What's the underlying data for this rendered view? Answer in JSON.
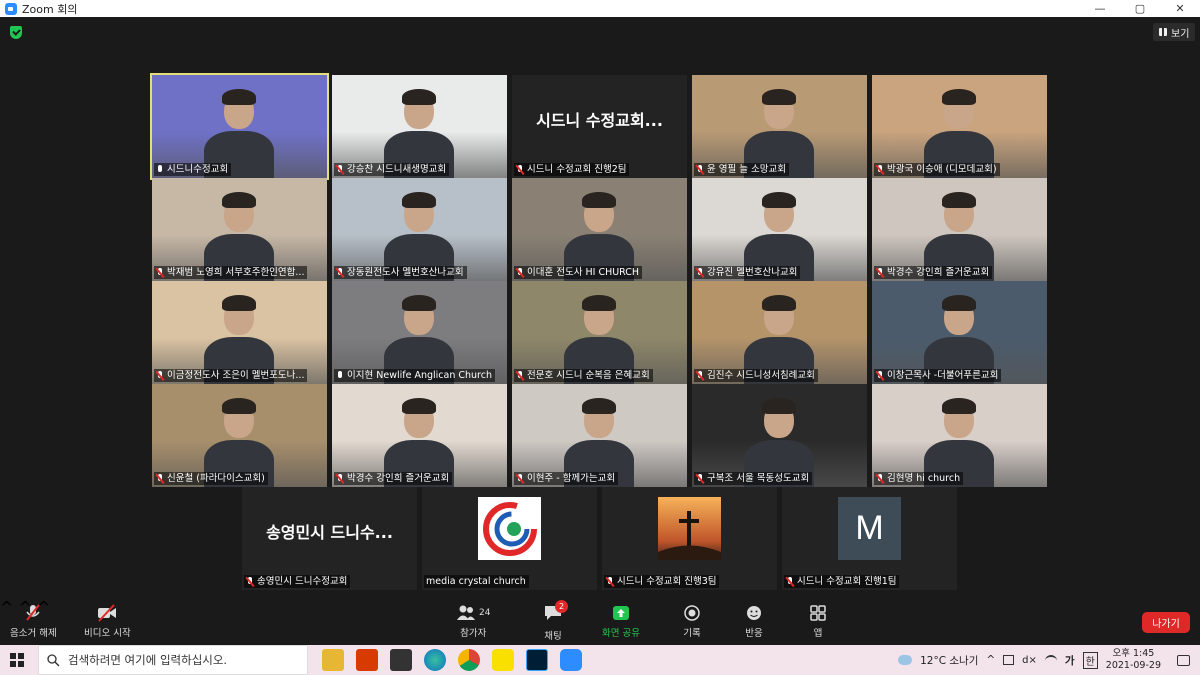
{
  "window": {
    "title": "Zoom 회의",
    "controls": [
      "—",
      "▢",
      "✕"
    ]
  },
  "view_button": "보기",
  "tiles": [
    {
      "name": "시드니수정교회",
      "muted": false,
      "active": true,
      "kind": "video",
      "bg": "#6f71c7"
    },
    {
      "name": "강승찬 시드니새생명교회",
      "muted": true,
      "kind": "video",
      "bg": "#e9eaea"
    },
    {
      "name": "시드니 수정교회 진행2팀",
      "muted": true,
      "kind": "text",
      "display": "시드니 수정교회..."
    },
    {
      "name": "윤 영필 늘 소망교회",
      "muted": true,
      "kind": "video",
      "bg": "#b89a74"
    },
    {
      "name": "박광국 이승애 (디모데교회)",
      "muted": true,
      "kind": "video",
      "bg": "#c9a47e"
    },
    {
      "name": "박재범 노영희 서부호주한인연합...",
      "muted": true,
      "kind": "video",
      "bg": "#c7b8a6"
    },
    {
      "name": "장동원전도사 멜번호산나교회",
      "muted": true,
      "kind": "video",
      "bg": "#b7c0c8"
    },
    {
      "name": "이대훈 전도사 HI CHURCH",
      "muted": true,
      "kind": "video",
      "bg": "#8a8174"
    },
    {
      "name": "강유진 멜번호산나교회",
      "muted": true,
      "kind": "video",
      "bg": "#dcd8d3"
    },
    {
      "name": "박경수 강인희 즐거운교회",
      "muted": true,
      "kind": "video",
      "bg": "#cfc7bf"
    },
    {
      "name": "이금정전도사 조은이 멜번포도나...",
      "muted": true,
      "kind": "video",
      "bg": "#d9c3a2"
    },
    {
      "name": "이지현 Newlife Anglican Church",
      "muted": false,
      "kind": "video",
      "bg": "#7d7d80"
    },
    {
      "name": "전문호 시드니 순복음 은혜교회",
      "muted": true,
      "kind": "video",
      "bg": "#8f876a"
    },
    {
      "name": "김진수 시드니성서침례교회",
      "muted": true,
      "kind": "video",
      "bg": "#b5946a"
    },
    {
      "name": "이창근목사 -더불어푸른교회",
      "muted": true,
      "kind": "video",
      "bg": "#4b5b6c"
    },
    {
      "name": "신윤철 (파라다이스교회)",
      "muted": true,
      "kind": "video",
      "bg": "#a88f6c"
    },
    {
      "name": "박경수 강인희 즐거운교회",
      "muted": true,
      "kind": "video",
      "bg": "#e2dad0"
    },
    {
      "name": "이현주 - 함께가는교회",
      "muted": true,
      "kind": "video",
      "bg": "#cfc9c4"
    },
    {
      "name": "구복조 서울 목동성도교회",
      "muted": true,
      "kind": "video",
      "bg": "#2a2a2a"
    },
    {
      "name": "김현명 hi church",
      "muted": true,
      "kind": "video",
      "bg": "#d9cfc9"
    },
    {
      "name": "송영민시 드니수정교회",
      "muted": true,
      "kind": "text",
      "display": "송영민시 드니수..."
    },
    {
      "name": "media crystal church",
      "muted": false,
      "kind": "logo"
    },
    {
      "name": "시드니 수정교회 진행3팀",
      "muted": true,
      "kind": "cross"
    },
    {
      "name": "시드니 수정교회 진행1팀",
      "muted": true,
      "kind": "letter",
      "display": "M"
    }
  ],
  "toolbar": {
    "unmute": "음소거 해제",
    "start_video": "비디오 시작",
    "participants": "참가자",
    "participants_count": "24",
    "chat": "채팅",
    "chat_badge": "2",
    "share": "화면 공유",
    "record": "기록",
    "reactions": "반응",
    "apps": "앱",
    "leave": "나가기"
  },
  "taskbar": {
    "search_placeholder": "검색하려면 여기에 입력하십시오.",
    "weather": "12°C  소나기",
    "lang": "가",
    "ime": "한",
    "time": "오후 1:45",
    "date": "2021-09-29"
  },
  "colors": {
    "active_border": "#e3e07a",
    "leave": "#e02828",
    "share": "#23c552",
    "badge": "#e02828"
  }
}
